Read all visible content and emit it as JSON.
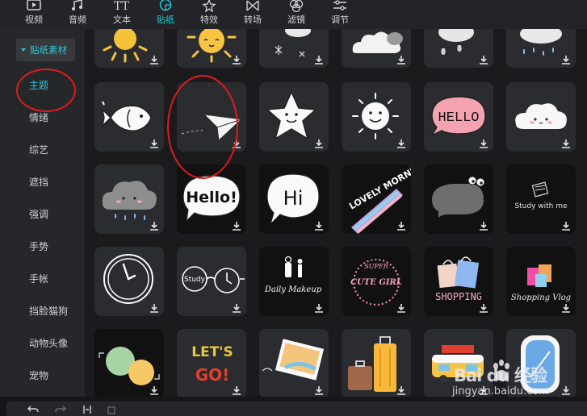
{
  "toolbar": {
    "tabs": [
      {
        "label": "视频",
        "icon": "video-icon"
      },
      {
        "label": "音频",
        "icon": "audio-icon"
      },
      {
        "label": "文本",
        "icon": "text-icon"
      },
      {
        "label": "贴纸",
        "icon": "sticker-icon",
        "active": true
      },
      {
        "label": "特效",
        "icon": "effects-icon"
      },
      {
        "label": "转场",
        "icon": "transition-icon"
      },
      {
        "label": "滤镜",
        "icon": "filter-icon"
      },
      {
        "label": "调节",
        "icon": "adjust-icon"
      }
    ]
  },
  "sidebar": {
    "header": "贴纸素材",
    "items": [
      {
        "label": "主题",
        "active": true
      },
      {
        "label": "情绪"
      },
      {
        "label": "综艺"
      },
      {
        "label": "遮挡"
      },
      {
        "label": "强调"
      },
      {
        "label": "手势"
      },
      {
        "label": "手帐"
      },
      {
        "label": "挡脸猫狗"
      },
      {
        "label": "动物头像"
      },
      {
        "label": "宠物"
      }
    ]
  },
  "stickers": {
    "hello_bubble": "Hello!",
    "hi_bubble": "Hi",
    "hello_oval": "HELLO",
    "lovely_morning": "LOVELY MORNING",
    "study_with_me": "Study with me",
    "study_glasses": "Study",
    "daily_makeup": "Daily Makeup",
    "super_cute_girl_top": "SUPER",
    "super_cute_girl_bottom": "CUTE GIRL",
    "shopping": "SHOPPING",
    "shopping_vlog": "Shopping Vlog",
    "lets_go_1": "LET'S",
    "lets_go_2": "GO!"
  },
  "watermark": {
    "brand": "Bai  du 经验",
    "url": "jingyan.baidu.com"
  },
  "colors": {
    "accent": "#2bc7d6",
    "annotation": "#e01b1b"
  }
}
